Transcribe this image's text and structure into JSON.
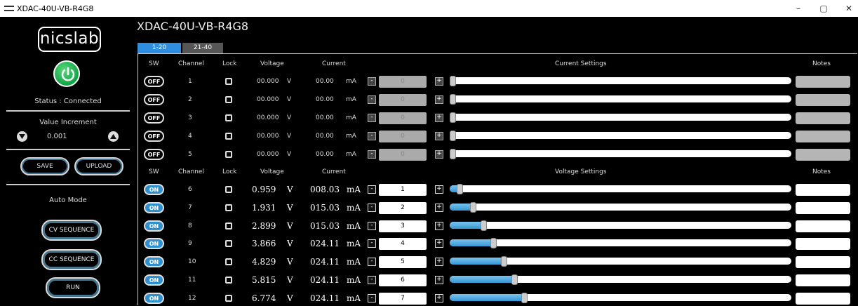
{
  "window": {
    "title": "XDAC-40U-VB-R4G8",
    "controls": [
      "–",
      "▢",
      "✕"
    ]
  },
  "sidebar": {
    "logo": "nicslab",
    "status": "Status : Connected",
    "value_increment_label": "Value Increment",
    "value_increment": "0.001",
    "save_label": "SAVE",
    "upload_label": "UPLOAD",
    "auto_mode_label": "Auto Mode",
    "cv_sequence_label": "CV SEQUENCE",
    "cc_sequence_label": "CC SEQUENCE",
    "run_label": "RUN"
  },
  "device": {
    "title": "XDAC-40U-VB-R4G8"
  },
  "tabs": [
    {
      "label": "1-20",
      "active": true
    },
    {
      "label": "21-40",
      "active": false
    }
  ],
  "current_section": {
    "headers": {
      "sw": "SW",
      "channel": "Channel",
      "lock": "Lock",
      "voltage": "Voltage",
      "current": "Current",
      "settings": "Current Settings",
      "notes": "Notes"
    },
    "rows": [
      {
        "sw": "OFF",
        "channel": "1",
        "voltage": "00.000",
        "vunit": "V",
        "current": "00.00",
        "cunit": "mA",
        "setting": "0",
        "minus": "-",
        "plus": "+"
      },
      {
        "sw": "OFF",
        "channel": "2",
        "voltage": "00.000",
        "vunit": "V",
        "current": "00.00",
        "cunit": "mA",
        "setting": "0",
        "minus": "-",
        "plus": "+"
      },
      {
        "sw": "OFF",
        "channel": "3",
        "voltage": "00.000",
        "vunit": "V",
        "current": "00.00",
        "cunit": "mA",
        "setting": "0",
        "minus": "-",
        "plus": "+"
      },
      {
        "sw": "OFF",
        "channel": "4",
        "voltage": "00.000",
        "vunit": "V",
        "current": "00.00",
        "cunit": "mA",
        "setting": "0",
        "minus": "-",
        "plus": "+"
      },
      {
        "sw": "OFF",
        "channel": "5",
        "voltage": "00.000",
        "vunit": "V",
        "current": "00.00",
        "cunit": "mA",
        "setting": "0",
        "minus": "-",
        "plus": "+"
      }
    ]
  },
  "voltage_section": {
    "headers": {
      "sw": "SW",
      "channel": "Channel",
      "lock": "Lock",
      "voltage": "Voltage",
      "current": "Current",
      "settings": "Voltage Settings",
      "notes": "Notes"
    },
    "rows": [
      {
        "sw": "ON",
        "channel": "6",
        "voltage": "0.959",
        "vunit": "V",
        "current": "008.03",
        "cunit": "mA",
        "setting": "1",
        "level": 0.02,
        "minus": "-",
        "plus": "+"
      },
      {
        "sw": "ON",
        "channel": "7",
        "voltage": "1.931",
        "vunit": "V",
        "current": "015.03",
        "cunit": "mA",
        "setting": "2",
        "level": 0.06,
        "minus": "-",
        "plus": "+"
      },
      {
        "sw": "ON",
        "channel": "8",
        "voltage": "2.899",
        "vunit": "V",
        "current": "015.03",
        "cunit": "mA",
        "setting": "3",
        "level": 0.09,
        "minus": "-",
        "plus": "+"
      },
      {
        "sw": "ON",
        "channel": "9",
        "voltage": "3.866",
        "vunit": "V",
        "current": "024.11",
        "cunit": "mA",
        "setting": "4",
        "level": 0.12,
        "minus": "-",
        "plus": "+"
      },
      {
        "sw": "ON",
        "channel": "10",
        "voltage": "4.829",
        "vunit": "V",
        "current": "024.11",
        "cunit": "mA",
        "setting": "5",
        "level": 0.15,
        "minus": "-",
        "plus": "+"
      },
      {
        "sw": "ON",
        "channel": "11",
        "voltage": "5.815",
        "vunit": "V",
        "current": "024.11",
        "cunit": "mA",
        "setting": "6",
        "level": 0.18,
        "minus": "-",
        "plus": "+"
      },
      {
        "sw": "ON",
        "channel": "12",
        "voltage": "6.774",
        "vunit": "V",
        "current": "024.11",
        "cunit": "mA",
        "setting": "7",
        "level": 0.21,
        "minus": "-",
        "plus": "+"
      }
    ]
  },
  "colors": {
    "accent": "#2e90d0",
    "power_green": "#13a447",
    "background": "#000000"
  }
}
